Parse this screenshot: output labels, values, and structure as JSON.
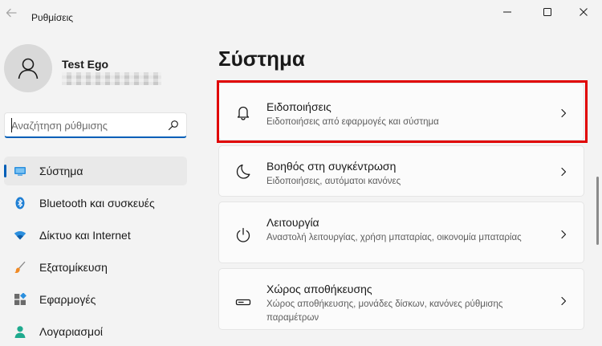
{
  "window": {
    "title": "Ρυθμίσεις"
  },
  "profile": {
    "name": "Test Ego"
  },
  "search": {
    "placeholder": "Αναζήτηση ρύθμισης",
    "value": ""
  },
  "sidebar": {
    "items": [
      {
        "label": "Σύστημα",
        "icon": "display-icon",
        "selected": true
      },
      {
        "label": "Bluetooth και συσκευές",
        "icon": "bluetooth-icon",
        "selected": false
      },
      {
        "label": "Δίκτυο και Internet",
        "icon": "wifi-icon",
        "selected": false
      },
      {
        "label": "Εξατομίκευση",
        "icon": "paintbrush-icon",
        "selected": false
      },
      {
        "label": "Εφαρμογές",
        "icon": "apps-icon",
        "selected": false
      },
      {
        "label": "Λογαριασμοί",
        "icon": "account-icon",
        "selected": false
      }
    ]
  },
  "main": {
    "title": "Σύστημα",
    "cards": [
      {
        "title": "Ειδοποιήσεις",
        "description": "Ειδοποιήσεις από εφαρμογές και σύστημα",
        "icon": "bell-icon"
      },
      {
        "title": "Βοηθός στη συγκέντρωση",
        "description": "Ειδοποιήσεις, αυτόματοι κανόνες",
        "icon": "moon-icon"
      },
      {
        "title": "Λειτουργία",
        "description": "Αναστολή λειτουργίας, χρήση μπαταρίας, οικονομία μπαταρίας",
        "icon": "power-icon"
      },
      {
        "title": "Χώρος αποθήκευσης",
        "description": "Χώρος αποθήκευσης, μονάδες δίσκων, κανόνες ρύθμισης παραμέτρων",
        "icon": "storage-icon"
      }
    ]
  },
  "colors": {
    "accent": "#005fb8",
    "highlight": "#e00000",
    "background": "#f3f3f3",
    "card": "#fbfbfb"
  }
}
